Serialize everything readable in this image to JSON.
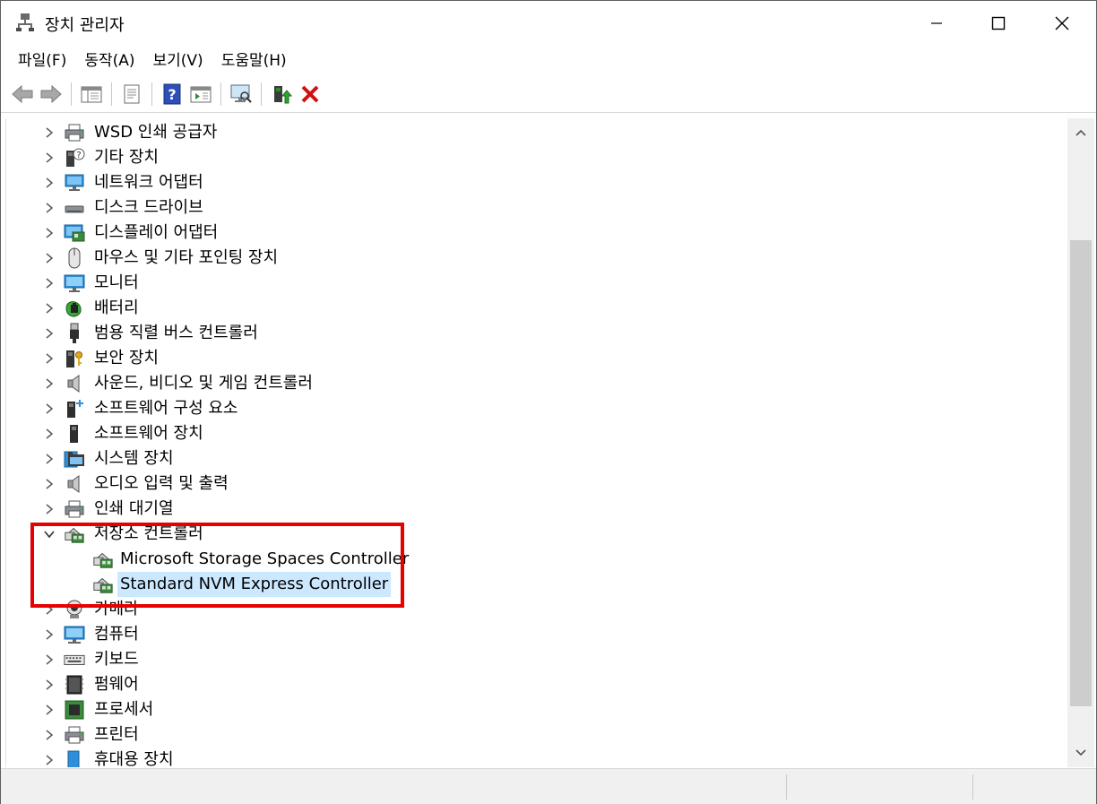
{
  "window": {
    "title": "장치 관리자"
  },
  "menu": [
    {
      "label": "파일(F)"
    },
    {
      "label": "동작(A)"
    },
    {
      "label": "보기(V)"
    },
    {
      "label": "도움말(H)"
    }
  ],
  "colors": {
    "accent_red": "#e60000",
    "selection": "#cce8ff"
  },
  "tree": {
    "categories": [
      {
        "label": "WSD 인쇄 공급자",
        "icon": "printer-icon",
        "expanded": false
      },
      {
        "label": "기타 장치",
        "icon": "unknown-device-icon",
        "expanded": false
      },
      {
        "label": "네트워크 어댑터",
        "icon": "network-adapter-icon",
        "expanded": false
      },
      {
        "label": "디스크 드라이브",
        "icon": "disk-drive-icon",
        "expanded": false
      },
      {
        "label": "디스플레이 어댑터",
        "icon": "display-adapter-icon",
        "expanded": false
      },
      {
        "label": "마우스 및 기타 포인팅 장치",
        "icon": "mouse-icon",
        "expanded": false
      },
      {
        "label": "모니터",
        "icon": "monitor-icon",
        "expanded": false
      },
      {
        "label": "배터리",
        "icon": "battery-icon",
        "expanded": false
      },
      {
        "label": "범용 직렬 버스 컨트롤러",
        "icon": "usb-icon",
        "expanded": false
      },
      {
        "label": "보안 장치",
        "icon": "security-device-icon",
        "expanded": false
      },
      {
        "label": "사운드, 비디오 및 게임 컨트롤러",
        "icon": "speaker-icon",
        "expanded": false
      },
      {
        "label": "소프트웨어 구성 요소",
        "icon": "software-component-icon",
        "expanded": false
      },
      {
        "label": "소프트웨어 장치",
        "icon": "software-device-icon",
        "expanded": false
      },
      {
        "label": "시스템 장치",
        "icon": "system-device-icon",
        "expanded": false
      },
      {
        "label": "오디오 입력 및 출력",
        "icon": "speaker-icon",
        "expanded": false
      },
      {
        "label": "인쇄 대기열",
        "icon": "printer-icon",
        "expanded": false
      },
      {
        "label": "저장소 컨트롤러",
        "icon": "storage-controller-icon",
        "expanded": true
      },
      {
        "label": "카메라",
        "icon": "camera-icon",
        "expanded": false
      },
      {
        "label": "컴퓨터",
        "icon": "computer-icon",
        "expanded": false
      },
      {
        "label": "키보드",
        "icon": "keyboard-icon",
        "expanded": false
      },
      {
        "label": "펌웨어",
        "icon": "firmware-icon",
        "expanded": false
      },
      {
        "label": "프로세서",
        "icon": "processor-icon",
        "expanded": false
      },
      {
        "label": "프린터",
        "icon": "printer-icon",
        "expanded": false
      },
      {
        "label": "휴대용 장치",
        "icon": "portable-device-icon",
        "expanded": false
      }
    ],
    "storage_children": [
      {
        "label": "Microsoft Storage Spaces Controller",
        "icon": "storage-controller-icon",
        "selected": false
      },
      {
        "label": "Standard NVM Express Controller",
        "icon": "storage-controller-icon",
        "selected": true
      }
    ]
  }
}
